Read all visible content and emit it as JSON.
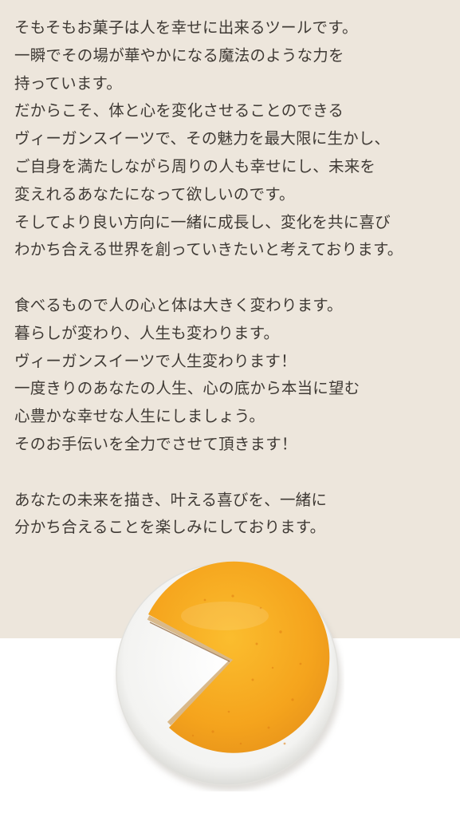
{
  "paragraphs": [
    {
      "lines": [
        "そもそもお菓子は人を幸せに出来るツールです。",
        "一瞬でその場が華やかになる魔法のような力を",
        "持っています。",
        "だからこそ、体と心を変化させることのできる",
        "ヴィーガンスイーツで、その魅力を最大限に生かし、",
        "ご自身を満たしながら周りの人も幸せにし、未来を",
        "変えれるあなたになって欲しいのです。",
        "そしてより良い方向に一緒に成長し、変化を共に喜び",
        "わかち合える世界を創っていきたいと考えております。"
      ]
    },
    {
      "lines": [
        "食べるもので人の心と体は大きく変わります。",
        "暮らしが変わり、人生も変わります。",
        "ヴィーガンスイーツで人生変わります！",
        "一度きりのあなたの人生、心の底から本当に望む",
        "心豊かな幸せな人生にしましょう。",
        "そのお手伝いを全力でさせて頂きます！"
      ]
    },
    {
      "lines": [
        "あなたの未来を描き、叶える喜びを、一緒に",
        "分かち合えることを楽しみにしております。"
      ]
    }
  ],
  "colors": {
    "background_top": "#ede6dc",
    "background_bottom": "#ffffff",
    "text": "#3f3a35",
    "cake": "#f5a623"
  }
}
